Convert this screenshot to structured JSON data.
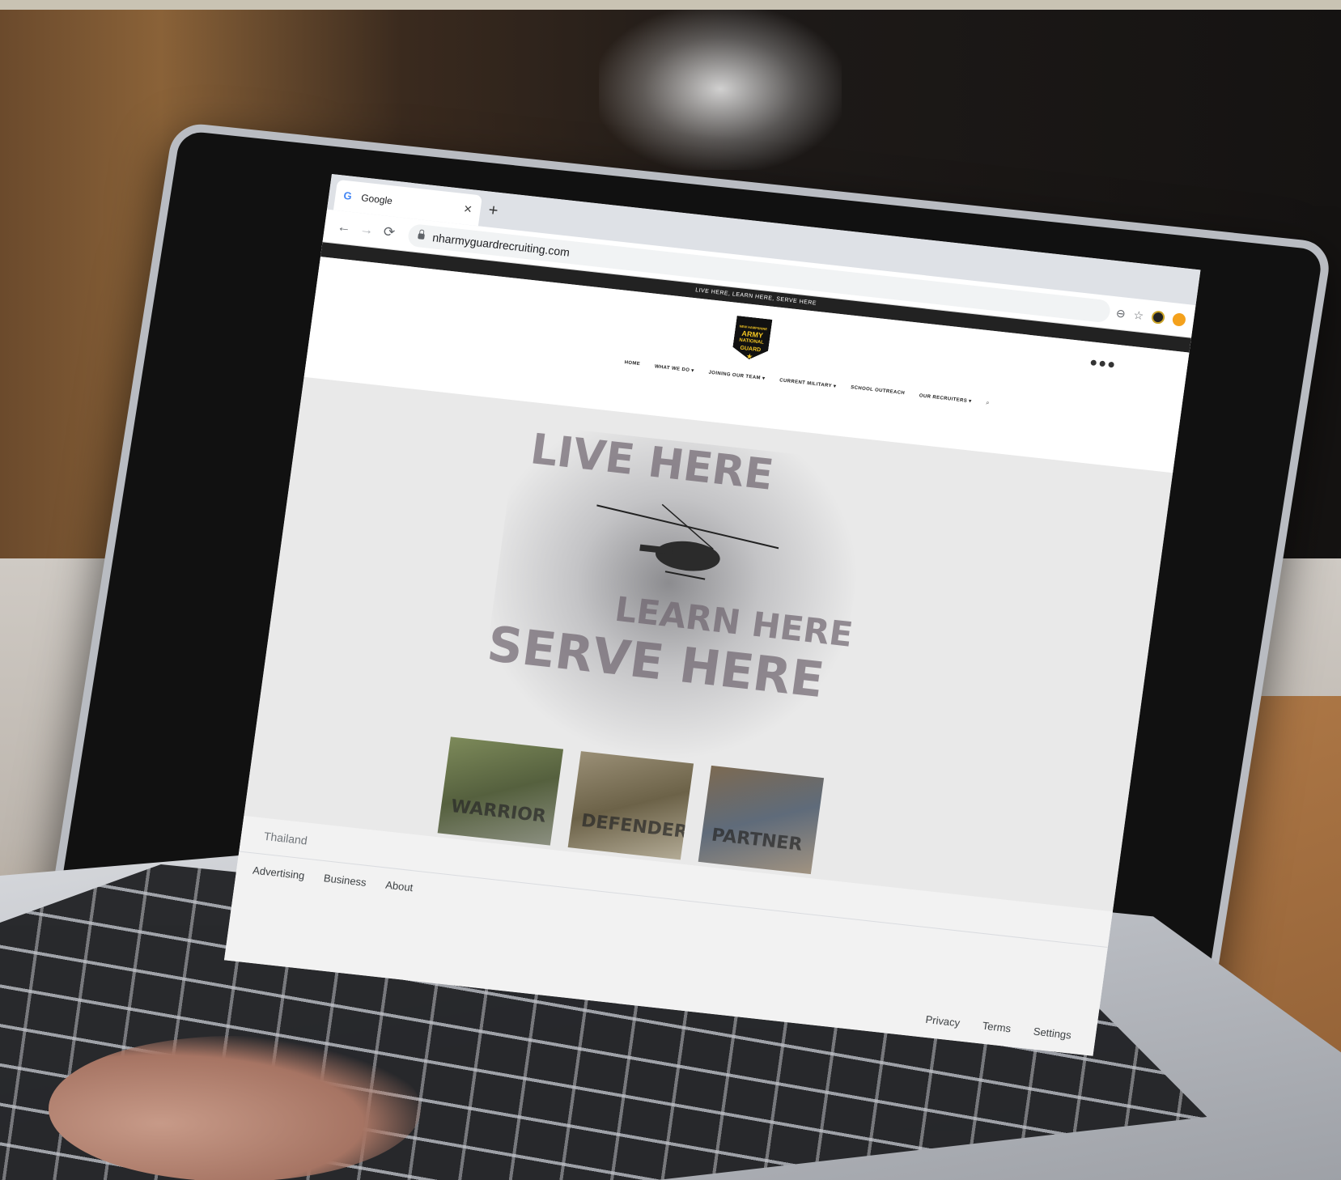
{
  "browser": {
    "tab_title": "Google",
    "tab_close": "✕",
    "new_tab": "+",
    "url": "nharmyguardrecruiting.com"
  },
  "site": {
    "announcement": "LIVE HERE, LEARN HERE, SERVE HERE",
    "logo_lines": [
      "NEW HAMPSHIRE",
      "ARMY",
      "NATIONAL",
      "GUARD"
    ],
    "nav": [
      {
        "label": "HOME"
      },
      {
        "label": "WHAT WE DO ▾"
      },
      {
        "label": "JOINING OUR TEAM ▾"
      },
      {
        "label": "CURRENT MILITARY ▾"
      },
      {
        "label": "SCHOOL OUTREACH"
      },
      {
        "label": "OUR RECRUITERS ▾"
      }
    ],
    "hero": {
      "line1": "LIVE HERE",
      "line2": "LEARN HERE",
      "line3": "SERVE HERE"
    },
    "cards": [
      {
        "label": "WARRIOR"
      },
      {
        "label": "DEFENDER"
      },
      {
        "label": "PARTNER"
      }
    ]
  },
  "google_footer": {
    "country": "Thailand",
    "left_links": [
      "Advertising",
      "Business",
      "About"
    ],
    "right_links": [
      "Privacy",
      "Terms",
      "Settings"
    ]
  },
  "colors": {
    "accent_gold": "#f3c623",
    "announcement_bar": "#222222"
  },
  "icons": {
    "back": "back-arrow-icon",
    "forward": "forward-arrow-icon",
    "reload": "reload-icon",
    "lock": "lock-icon",
    "zoom": "zoom-icon",
    "bookmark": "star-icon"
  }
}
